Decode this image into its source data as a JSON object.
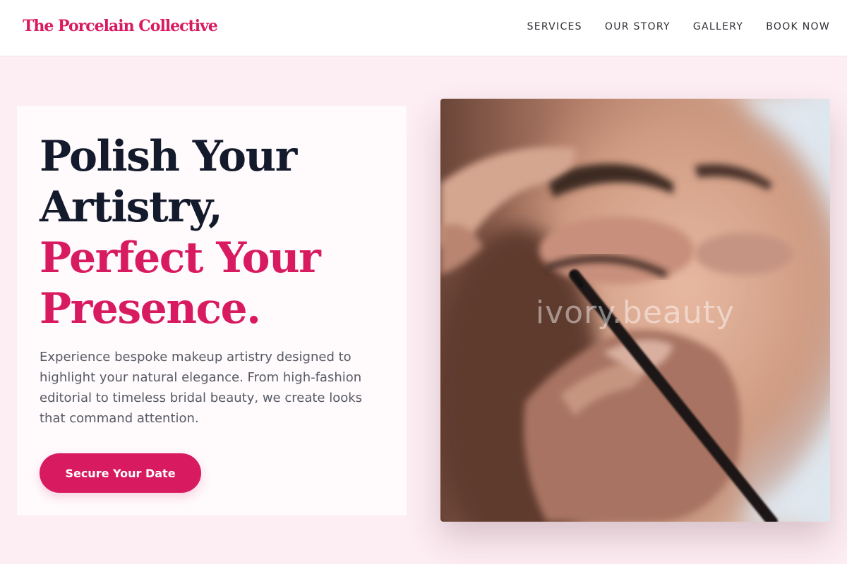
{
  "header": {
    "brand": "The Porcelain Collective",
    "nav": [
      {
        "label": "SERVICES"
      },
      {
        "label": "OUR STORY"
      },
      {
        "label": "GALLERY"
      },
      {
        "label": "BOOK NOW"
      }
    ]
  },
  "hero": {
    "headline_line1": "Polish Your",
    "headline_line2": "Artistry,",
    "headline_line3": "Perfect Your",
    "headline_line4": "Presence.",
    "description": "Experience bespoke makeup artistry designed to highlight your natural elegance. From high-fashion editorial to timeless bridal beauty, we create looks that command attention.",
    "cta_label": "Secure Your Date"
  },
  "image": {
    "watermark": "ivory.beauty",
    "subject_icon": "makeup-application-photo"
  },
  "colors": {
    "accent": "#d81b60",
    "headline_dark": "#131a2c",
    "page_background": "#fdeef3",
    "card_background": "#fffafc",
    "body_text": "#555a64"
  }
}
